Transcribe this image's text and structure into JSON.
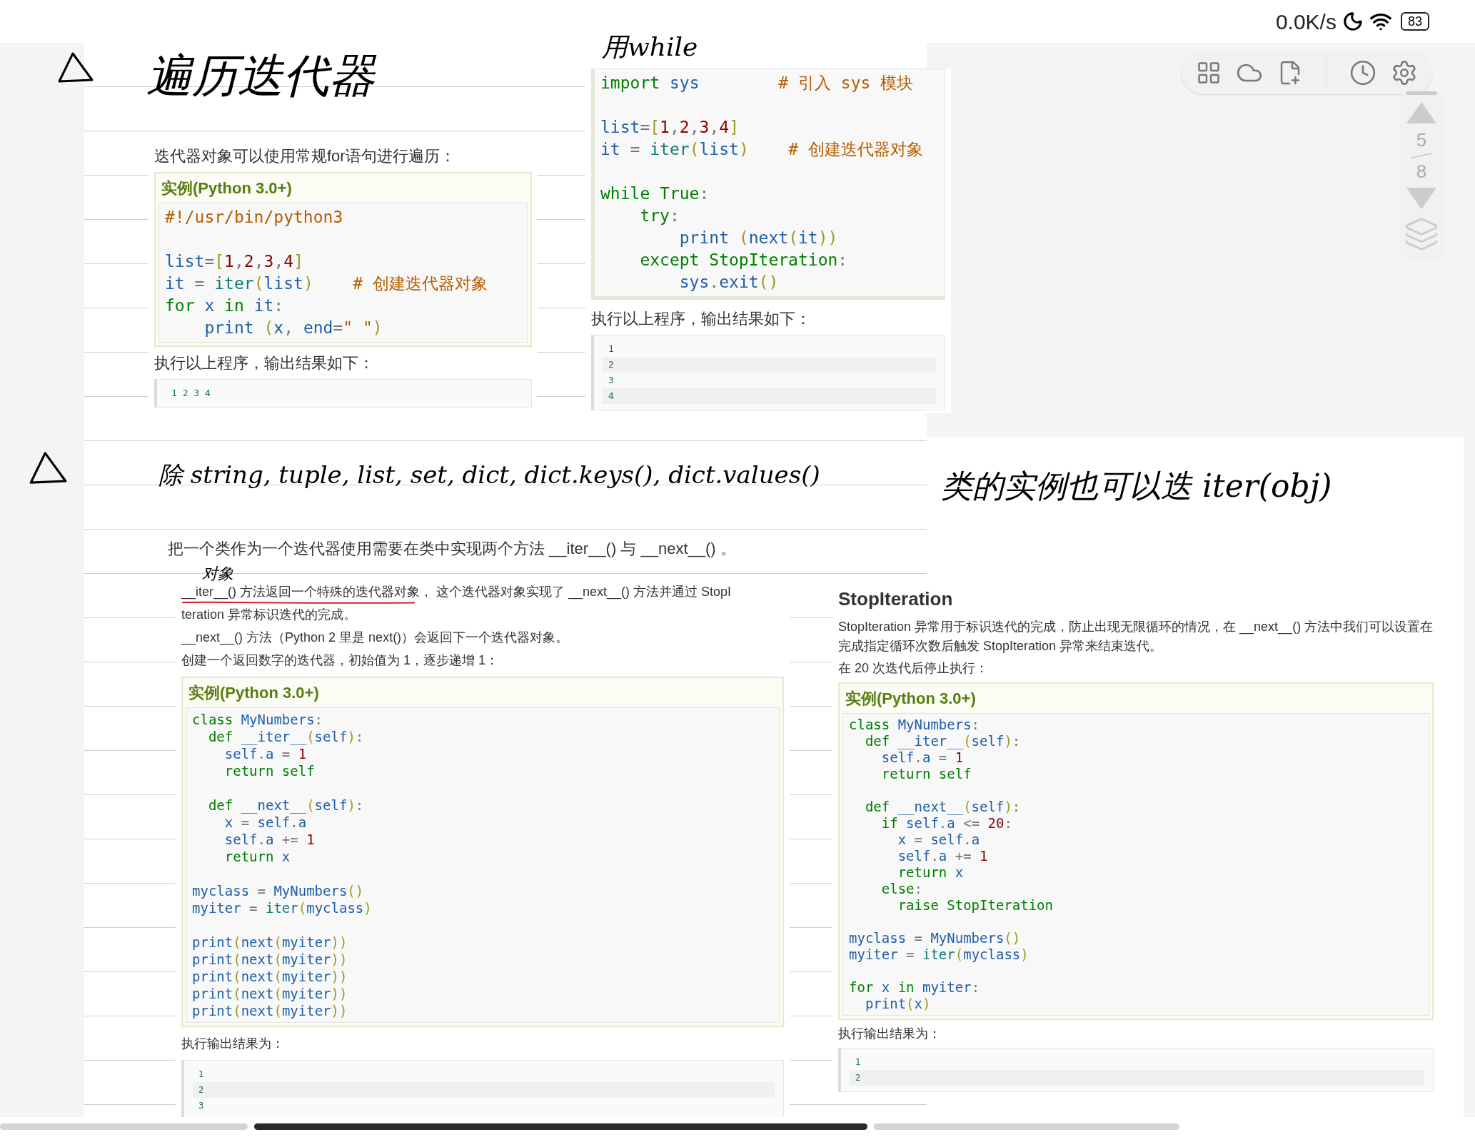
{
  "status_bar": {
    "speed": "0.0K/s",
    "battery": "83"
  },
  "pager": {
    "current": "5",
    "total": "8"
  },
  "clips": [
    {
      "items": [
        {
          "kind": "text",
          "text": "迭代器对象可以使用常规for语句进行遍历："
        },
        {
          "kind": "example",
          "title": "实例(Python 3.0+)",
          "code": [
            [
              [
                {
                  "kind": "comment",
                  "text": "#!/usr/bin/python3"
                }
              ]
            ],
            [
              [
                {
                  "kind": "name",
                  "text": "list"
                },
                {
                  "kind": "operator",
                  "text": "="
                },
                {
                  "kind": "punct",
                  "text": "["
                },
                {
                  "kind": "number",
                  "text": "1"
                },
                {
                  "kind": "operator",
                  "text": ","
                },
                {
                  "kind": "number",
                  "text": "2"
                },
                {
                  "kind": "operator",
                  "text": ","
                },
                {
                  "kind": "number",
                  "text": "3"
                },
                {
                  "kind": "operator",
                  "text": ","
                },
                {
                  "kind": "number",
                  "text": "4"
                },
                {
                  "kind": "punct",
                  "text": "]"
                }
              ],
              [
                {
                  "kind": "name",
                  "text": "it"
                },
                {
                  "kind": "operator",
                  "text": " = "
                },
                {
                  "kind": "builtin",
                  "text": "iter"
                },
                {
                  "kind": "punct",
                  "text": "("
                },
                {
                  "kind": "name",
                  "text": "list"
                },
                {
                  "kind": "punct",
                  "text": ")"
                },
                {
                  "kind": "comment",
                  "text": "    # 创建迭代器对象"
                }
              ],
              [
                {
                  "kind": "keyword",
                  "text": "for"
                },
                {
                  "kind": "name",
                  "text": " x "
                },
                {
                  "kind": "keyword",
                  "text": "in"
                },
                {
                  "kind": "name",
                  "text": " it"
                },
                {
                  "kind": "operator",
                  "text": ":"
                }
              ],
              [
                {
                  "kind": "name",
                  "text": "    print "
                },
                {
                  "kind": "punct",
                  "text": "("
                },
                {
                  "kind": "name",
                  "text": "x"
                },
                {
                  "kind": "operator",
                  "text": ", "
                },
                {
                  "kind": "name",
                  "text": "end"
                },
                {
                  "kind": "operator",
                  "text": "="
                },
                {
                  "kind": "comment",
                  "text": "\" \""
                },
                {
                  "kind": "punct",
                  "text": ")"
                }
              ]
            ]
          ]
        },
        {
          "kind": "text",
          "text": "执行以上程序，输出结果如下："
        },
        {
          "kind": "output",
          "lines": [
            "1 2 3 4"
          ]
        }
      ]
    },
    {
      "items": [
        {
          "kind": "code",
          "code": [
            [
              [
                {
                  "kind": "keyword",
                  "text": "import"
                },
                {
                  "kind": "name",
                  "text": " sys"
                },
                {
                  "kind": "comment",
                  "text": "        # 引入 sys 模块"
                }
              ]
            ],
            [
              [
                {
                  "kind": "name",
                  "text": "list"
                },
                {
                  "kind": "operator",
                  "text": "="
                },
                {
                  "kind": "punct",
                  "text": "["
                },
                {
                  "kind": "number",
                  "text": "1"
                },
                {
                  "kind": "operator",
                  "text": ","
                },
                {
                  "kind": "number",
                  "text": "2"
                },
                {
                  "kind": "operator",
                  "text": ","
                },
                {
                  "kind": "number",
                  "text": "3"
                },
                {
                  "kind": "operator",
                  "text": ","
                },
                {
                  "kind": "number",
                  "text": "4"
                },
                {
                  "kind": "punct",
                  "text": "]"
                }
              ],
              [
                {
                  "kind": "name",
                  "text": "it"
                },
                {
                  "kind": "operator",
                  "text": " = "
                },
                {
                  "kind": "builtin",
                  "text": "iter"
                },
                {
                  "kind": "punct",
                  "text": "("
                },
                {
                  "kind": "name",
                  "text": "list"
                },
                {
                  "kind": "punct",
                  "text": ")"
                },
                {
                  "kind": "comment",
                  "text": "    # 创建迭代器对象"
                }
              ]
            ],
            [
              [
                {
                  "kind": "keyword",
                  "text": "while True"
                },
                {
                  "kind": "operator",
                  "text": ":"
                }
              ],
              [
                {
                  "kind": "keyword",
                  "text": "    try"
                },
                {
                  "kind": "operator",
                  "text": ":"
                }
              ],
              [
                {
                  "kind": "name",
                  "text": "        print "
                },
                {
                  "kind": "punct",
                  "text": "("
                },
                {
                  "kind": "name",
                  "text": "next"
                },
                {
                  "kind": "punct",
                  "text": "("
                },
                {
                  "kind": "name",
                  "text": "it"
                },
                {
                  "kind": "punct",
                  "text": "))"
                }
              ],
              [
                {
                  "kind": "keyword",
                  "text": "    except StopIteration"
                },
                {
                  "kind": "operator",
                  "text": ":"
                }
              ],
              [
                {
                  "kind": "name",
                  "text": "        sys"
                },
                {
                  "kind": "operator",
                  "text": "."
                },
                {
                  "kind": "name",
                  "text": "exit"
                },
                {
                  "kind": "punct",
                  "text": "()"
                }
              ]
            ]
          ]
        },
        {
          "kind": "text",
          "text": "执行以上程序，输出结果如下："
        },
        {
          "kind": "output",
          "lines": [
            "1",
            "2",
            "3",
            "4"
          ]
        }
      ]
    },
    {
      "items": [
        {
          "kind": "text",
          "text": "把一个类作为一个迭代器使用需要在类中实现两个方法 __iter__() 与 __next__() 。"
        }
      ]
    },
    {
      "items": [
        {
          "kind": "text",
          "text": "__iter__() 方法返回一个特殊的迭代器对象， 这个迭代器对象实现了 __next__() 方法并通过 StopI"
        },
        {
          "kind": "text",
          "text": "teration 异常标识迭代的完成。"
        },
        {
          "kind": "text",
          "text": "__next__() 方法（Python 2 里是 next()）会返回下一个迭代器对象。"
        },
        {
          "kind": "text",
          "text": "创建一个返回数字的迭代器，初始值为 1，逐步递增 1："
        },
        {
          "kind": "example",
          "title": "实例(Python 3.0+)",
          "code": [
            [
              [
                {
                  "kind": "keyword",
                  "text": "class"
                },
                {
                  "kind": "name",
                  "text": " MyNumbers"
                },
                {
                  "kind": "operator",
                  "text": ":"
                }
              ],
              [
                {
                  "kind": "keyword",
                  "text": "  def"
                },
                {
                  "kind": "name",
                  "text": " __iter__"
                },
                {
                  "kind": "punct",
                  "text": "("
                },
                {
                  "kind": "name",
                  "text": "self"
                },
                {
                  "kind": "punct",
                  "text": ")"
                },
                {
                  "kind": "operator",
                  "text": ":"
                }
              ],
              [
                {
                  "kind": "name",
                  "text": "    self"
                },
                {
                  "kind": "operator",
                  "text": "."
                },
                {
                  "kind": "name",
                  "text": "a"
                },
                {
                  "kind": "operator",
                  "text": " = "
                },
                {
                  "kind": "number",
                  "text": "1"
                }
              ],
              [
                {
                  "kind": "keyword",
                  "text": "    return self"
                }
              ]
            ],
            [
              [
                {
                  "kind": "keyword",
                  "text": "  def"
                },
                {
                  "kind": "name",
                  "text": " __next__"
                },
                {
                  "kind": "punct",
                  "text": "("
                },
                {
                  "kind": "name",
                  "text": "self"
                },
                {
                  "kind": "punct",
                  "text": ")"
                },
                {
                  "kind": "operator",
                  "text": ":"
                }
              ],
              [
                {
                  "kind": "name",
                  "text": "    x"
                },
                {
                  "kind": "operator",
                  "text": " = "
                },
                {
                  "kind": "name",
                  "text": "self"
                },
                {
                  "kind": "operator",
                  "text": "."
                },
                {
                  "kind": "name",
                  "text": "a"
                }
              ],
              [
                {
                  "kind": "name",
                  "text": "    self"
                },
                {
                  "kind": "operator",
                  "text": "."
                },
                {
                  "kind": "name",
                  "text": "a"
                },
                {
                  "kind": "operator",
                  "text": " += "
                },
                {
                  "kind": "number",
                  "text": "1"
                }
              ],
              [
                {
                  "kind": "keyword",
                  "text": "    return"
                },
                {
                  "kind": "name",
                  "text": " x"
                }
              ]
            ],
            [
              [
                {
                  "kind": "name",
                  "text": "myclass"
                },
                {
                  "kind": "operator",
                  "text": " = "
                },
                {
                  "kind": "name",
                  "text": "MyNumbers"
                },
                {
                  "kind": "punct",
                  "text": "()"
                }
              ],
              [
                {
                  "kind": "name",
                  "text": "myiter"
                },
                {
                  "kind": "operator",
                  "text": " = "
                },
                {
                  "kind": "builtin",
                  "text": "iter"
                },
                {
                  "kind": "punct",
                  "text": "("
                },
                {
                  "kind": "name",
                  "text": "myclass"
                },
                {
                  "kind": "punct",
                  "text": ")"
                }
              ]
            ],
            [
              [
                {
                  "kind": "name",
                  "text": "print"
                },
                {
                  "kind": "punct",
                  "text": "("
                },
                {
                  "kind": "name",
                  "text": "next"
                },
                {
                  "kind": "punct",
                  "text": "("
                },
                {
                  "kind": "name",
                  "text": "myiter"
                },
                {
                  "kind": "punct",
                  "text": "))"
                }
              ],
              [
                {
                  "kind": "name",
                  "text": "print"
                },
                {
                  "kind": "punct",
                  "text": "("
                },
                {
                  "kind": "name",
                  "text": "next"
                },
                {
                  "kind": "punct",
                  "text": "("
                },
                {
                  "kind": "name",
                  "text": "myiter"
                },
                {
                  "kind": "punct",
                  "text": "))"
                }
              ],
              [
                {
                  "kind": "name",
                  "text": "print"
                },
                {
                  "kind": "punct",
                  "text": "("
                },
                {
                  "kind": "name",
                  "text": "next"
                },
                {
                  "kind": "punct",
                  "text": "("
                },
                {
                  "kind": "name",
                  "text": "myiter"
                },
                {
                  "kind": "punct",
                  "text": "))"
                }
              ],
              [
                {
                  "kind": "name",
                  "text": "print"
                },
                {
                  "kind": "punct",
                  "text": "("
                },
                {
                  "kind": "name",
                  "text": "next"
                },
                {
                  "kind": "punct",
                  "text": "("
                },
                {
                  "kind": "name",
                  "text": "myiter"
                },
                {
                  "kind": "punct",
                  "text": "))"
                }
              ],
              [
                {
                  "kind": "name",
                  "text": "print"
                },
                {
                  "kind": "punct",
                  "text": "("
                },
                {
                  "kind": "name",
                  "text": "next"
                },
                {
                  "kind": "punct",
                  "text": "("
                },
                {
                  "kind": "name",
                  "text": "myiter"
                },
                {
                  "kind": "punct",
                  "text": "))"
                }
              ]
            ]
          ]
        },
        {
          "kind": "text",
          "text": "执行输出结果为："
        },
        {
          "kind": "output",
          "lines": [
            "1",
            "2",
            "3"
          ]
        }
      ]
    },
    {
      "items": [
        {
          "kind": "heading",
          "text": "StopIteration"
        },
        {
          "kind": "text",
          "text": "StopIteration 异常用于标识迭代的完成，防止出现无限循环的情况，在 __next__() 方法中我们可以设置在完成指定循环次数后触发 StopIteration 异常来结束迭代。"
        },
        {
          "kind": "text",
          "text": "在 20 次迭代后停止执行："
        },
        {
          "kind": "example",
          "title": "实例(Python 3.0+)",
          "code": [
            [
              [
                {
                  "kind": "keyword",
                  "text": "class"
                },
                {
                  "kind": "name",
                  "text": " MyNumbers"
                },
                {
                  "kind": "operator",
                  "text": ":"
                }
              ],
              [
                {
                  "kind": "keyword",
                  "text": "  def"
                },
                {
                  "kind": "name",
                  "text": " __iter__"
                },
                {
                  "kind": "punct",
                  "text": "("
                },
                {
                  "kind": "name",
                  "text": "self"
                },
                {
                  "kind": "punct",
                  "text": ")"
                },
                {
                  "kind": "operator",
                  "text": ":"
                }
              ],
              [
                {
                  "kind": "name",
                  "text": "    self"
                },
                {
                  "kind": "operator",
                  "text": "."
                },
                {
                  "kind": "name",
                  "text": "a"
                },
                {
                  "kind": "operator",
                  "text": " = "
                },
                {
                  "kind": "number",
                  "text": "1"
                }
              ],
              [
                {
                  "kind": "keyword",
                  "text": "    return self"
                }
              ]
            ],
            [
              [
                {
                  "kind": "keyword",
                  "text": "  def"
                },
                {
                  "kind": "name",
                  "text": " __next__"
                },
                {
                  "kind": "punct",
                  "text": "("
                },
                {
                  "kind": "name",
                  "text": "self"
                },
                {
                  "kind": "punct",
                  "text": ")"
                },
                {
                  "kind": "operator",
                  "text": ":"
                }
              ],
              [
                {
                  "kind": "keyword",
                  "text": "    if"
                },
                {
                  "kind": "name",
                  "text": " self"
                },
                {
                  "kind": "operator",
                  "text": "."
                },
                {
                  "kind": "name",
                  "text": "a"
                },
                {
                  "kind": "operator",
                  "text": " <= "
                },
                {
                  "kind": "number",
                  "text": "20"
                },
                {
                  "kind": "operator",
                  "text": ":"
                }
              ],
              [
                {
                  "kind": "name",
                  "text": "      x"
                },
                {
                  "kind": "operator",
                  "text": " = "
                },
                {
                  "kind": "name",
                  "text": "self"
                },
                {
                  "kind": "operator",
                  "text": "."
                },
                {
                  "kind": "name",
                  "text": "a"
                }
              ],
              [
                {
                  "kind": "name",
                  "text": "      self"
                },
                {
                  "kind": "operator",
                  "text": "."
                },
                {
                  "kind": "name",
                  "text": "a"
                },
                {
                  "kind": "operator",
                  "text": " += "
                },
                {
                  "kind": "number",
                  "text": "1"
                }
              ],
              [
                {
                  "kind": "keyword",
                  "text": "      return"
                },
                {
                  "kind": "name",
                  "text": " x"
                }
              ],
              [
                {
                  "kind": "keyword",
                  "text": "    else"
                },
                {
                  "kind": "operator",
                  "text": ":"
                }
              ],
              [
                {
                  "kind": "keyword",
                  "text": "      raise StopIteration"
                }
              ]
            ],
            [
              [
                {
                  "kind": "name",
                  "text": "myclass"
                },
                {
                  "kind": "operator",
                  "text": " = "
                },
                {
                  "kind": "name",
                  "text": "MyNumbers"
                },
                {
                  "kind": "punct",
                  "text": "()"
                }
              ],
              [
                {
                  "kind": "name",
                  "text": "myiter"
                },
                {
                  "kind": "operator",
                  "text": " = "
                },
                {
                  "kind": "builtin",
                  "text": "iter"
                },
                {
                  "kind": "punct",
                  "text": "("
                },
                {
                  "kind": "name",
                  "text": "myclass"
                },
                {
                  "kind": "punct",
                  "text": ")"
                }
              ]
            ],
            [
              [
                {
                  "kind": "keyword",
                  "text": "for"
                },
                {
                  "kind": "name",
                  "text": " x "
                },
                {
                  "kind": "keyword",
                  "text": "in"
                },
                {
                  "kind": "name",
                  "text": " myiter"
                },
                {
                  "kind": "operator",
                  "text": ":"
                }
              ],
              [
                {
                  "kind": "name",
                  "text": "  print"
                },
                {
                  "kind": "punct",
                  "text": "("
                },
                {
                  "kind": "name",
                  "text": "x"
                },
                {
                  "kind": "punct",
                  "text": ")"
                }
              ]
            ]
          ]
        },
        {
          "kind": "text",
          "text": "执行输出结果为："
        },
        {
          "kind": "output",
          "lines": [
            "1",
            "2"
          ]
        }
      ]
    }
  ],
  "annotations": [
    {
      "kind": "triangle"
    },
    {
      "kind": "text",
      "text": "遍历迭代器"
    },
    {
      "kind": "text",
      "text": "用while"
    },
    {
      "kind": "triangle"
    },
    {
      "kind": "text",
      "text": "除 string, tuple, list, set, dict, dict.keys(), dict.values()"
    },
    {
      "kind": "text",
      "text": "类的实例也可以迭 iter(obj)"
    },
    {
      "kind": "text",
      "text": "对象"
    },
    {
      "kind": "underline"
    }
  ]
}
